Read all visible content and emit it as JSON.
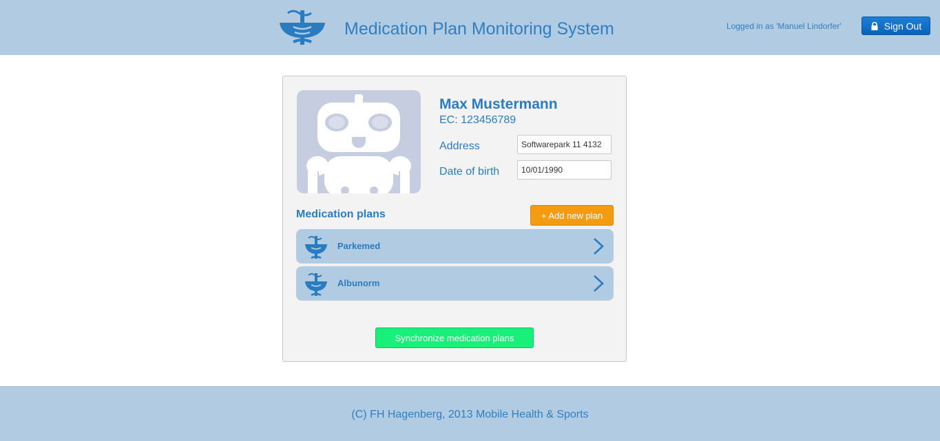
{
  "header": {
    "app_title": "Medication Plan Monitoring System",
    "logged_in_text": "Logged in as 'Manuel Lindorfer'",
    "sign_out_label": "Sign Out",
    "logo_icon": "caduceus-icon"
  },
  "patient": {
    "avatar_icon": "robot-avatar-icon",
    "name": "Max Mustermann",
    "ec": "EC: 123456789",
    "address_label": "Address",
    "address_value": "Softwarepark 11 4132",
    "dob_label": "Date of birth",
    "dob_value": "10/01/1990"
  },
  "plans": {
    "title": "Medication plans",
    "add_label": "+ Add new plan",
    "items": [
      {
        "name": "Parkemed",
        "icon": "caduceus-icon"
      },
      {
        "name": "Albunorm",
        "icon": "caduceus-icon"
      }
    ],
    "sync_label": "Synchronize medication plans"
  },
  "footer": {
    "text": "(C) FH Hagenberg, 2013 Mobile Health & Sports"
  },
  "colors": {
    "header_bg": "#b1cbe3",
    "accent_blue": "#2a7cc1",
    "add_button": "#f39c12",
    "sync_button": "#19f07a",
    "sign_out_button": "#0b62b8"
  }
}
